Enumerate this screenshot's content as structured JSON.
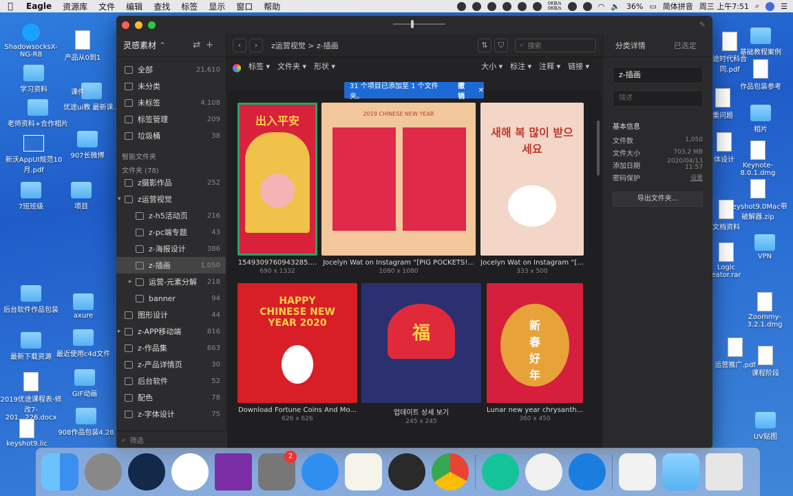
{
  "menubar": {
    "app": "Eagle",
    "items": [
      "资源库",
      "文件",
      "编辑",
      "查找",
      "标签",
      "显示",
      "窗口",
      "帮助"
    ],
    "net_up": "0KB/s",
    "net_down": "0KB/s",
    "battery": "36%",
    "ime": "简体拼音",
    "datetime": "周三 上午7:51"
  },
  "desktop": {
    "left": [
      {
        "label": "ShadowsocksX-NG-R8",
        "kind": "app"
      },
      {
        "label": "产品从0到1",
        "kind": "doc"
      },
      {
        "label": "学习资料",
        "kind": "folder"
      },
      {
        "label": "优途ui教 最新课...",
        "kind": "folder"
      },
      {
        "label": "课件",
        "kind": "folder"
      },
      {
        "label": "老师资料+合作相片",
        "kind": "folder"
      },
      {
        "label": "新沃AppUI规范10月.pdf",
        "kind": "doc"
      },
      {
        "label": "907长微博",
        "kind": "folder"
      },
      {
        "label": "7班班级",
        "kind": "folder"
      },
      {
        "label": "项目",
        "kind": "folder"
      },
      {
        "label": "后台软件作品包装",
        "kind": "folder"
      },
      {
        "label": "axure",
        "kind": "folder"
      },
      {
        "label": "最新下载资源",
        "kind": "folder"
      },
      {
        "label": "最近使用c4d文件",
        "kind": "folder"
      },
      {
        "label": "2019优途课程表-修改7-201...226.docx",
        "kind": "doc"
      },
      {
        "label": "GIF动画",
        "kind": "folder"
      },
      {
        "label": "keyshot9.lic",
        "kind": "doc"
      },
      {
        "label": "908作品包装4.28",
        "kind": "folder"
      }
    ],
    "right": [
      {
        "label": "途时代科合同.pdf",
        "kind": "doc"
      },
      {
        "label": "基础教程案例",
        "kind": "folder"
      },
      {
        "label": "作品包装参考",
        "kind": "doc"
      },
      {
        "label": "重问题",
        "kind": "doc"
      },
      {
        "label": "相片",
        "kind": "folder"
      },
      {
        "label": "体设计",
        "kind": "doc"
      },
      {
        "label": "Keynote-8.0.1.dmg",
        "kind": "doc"
      },
      {
        "label": "keyshot9.0Mac带破解器.zip",
        "kind": "doc"
      },
      {
        "label": "文档资料",
        "kind": "doc"
      },
      {
        "label": "VPN",
        "kind": "folder"
      },
      {
        "label": "Logic eator.rar",
        "kind": "doc"
      },
      {
        "label": "Zoommy-3.2.1.dmg",
        "kind": "doc"
      },
      {
        "label": "运营推广.pdf",
        "kind": "doc"
      },
      {
        "label": "课程阶段",
        "kind": "doc"
      },
      {
        "label": "UV贴图",
        "kind": "folder"
      }
    ]
  },
  "sidebar": {
    "library": "灵感素材",
    "nav": [
      {
        "label": "全部",
        "count": "21,610"
      },
      {
        "label": "未分类",
        "count": ""
      },
      {
        "label": "未标签",
        "count": "4,108"
      },
      {
        "label": "标签管理",
        "count": "209"
      },
      {
        "label": "垃圾桶",
        "count": "38"
      }
    ],
    "smart_label": "智能文件夹",
    "folders_label": "文件夹 (78)",
    "folders": [
      {
        "label": "z摄影作品",
        "count": "252",
        "indent": 0,
        "arrow": ""
      },
      {
        "label": "z运营视觉",
        "count": "",
        "indent": 0,
        "arrow": "▾"
      },
      {
        "label": "z-h5活动页",
        "count": "216",
        "indent": 1,
        "arrow": ""
      },
      {
        "label": "z-pc端专题",
        "count": "43",
        "indent": 1,
        "arrow": ""
      },
      {
        "label": "z-海报设计",
        "count": "386",
        "indent": 1,
        "arrow": ""
      },
      {
        "label": "z-插画",
        "count": "1,050",
        "indent": 1,
        "arrow": "",
        "selected": true
      },
      {
        "label": "运营-元素分解",
        "count": "218",
        "indent": 1,
        "arrow": "▸"
      },
      {
        "label": "banner",
        "count": "94",
        "indent": 1,
        "arrow": ""
      },
      {
        "label": "图形设计",
        "count": "44",
        "indent": 0,
        "arrow": ""
      },
      {
        "label": "z-APP移动端",
        "count": "816",
        "indent": 0,
        "arrow": "▸"
      },
      {
        "label": "z-作品集",
        "count": "663",
        "indent": 0,
        "arrow": ""
      },
      {
        "label": "z-产品详情页",
        "count": "30",
        "indent": 0,
        "arrow": ""
      },
      {
        "label": "后台软件",
        "count": "52",
        "indent": 0,
        "arrow": ""
      },
      {
        "label": "配色",
        "count": "78",
        "indent": 0,
        "arrow": ""
      },
      {
        "label": "z-字体设计",
        "count": "75",
        "indent": 0,
        "arrow": ""
      }
    ],
    "filter_placeholder": "筛选"
  },
  "toolbar": {
    "breadcrumb": "z运营视觉 > z-插画",
    "search_placeholder": "搜索"
  },
  "filters": [
    "标签",
    "文件夹",
    "形状",
    "",
    "",
    "",
    "",
    "大小",
    "标注",
    "注释",
    "链接"
  ],
  "toast": {
    "message": "31 个项目已添加至 1 个文件夹。",
    "undo": "撤销",
    "close": "✕"
  },
  "items": [
    {
      "name": "1549309760943285....",
      "size": "690 x 1332",
      "bg": "#d8213a",
      "caption": "出入平安"
    },
    {
      "name": "Jocelyn Wat on Instagram “[PIG POCKETS!...",
      "size": "1080 x 1080",
      "bg": "#f2c79b",
      "caption": "2019 CHINESE NEW YEAR"
    },
    {
      "name": "Jocelyn Wat on Instagram “[...",
      "size": "333 x 500",
      "bg": "#f4d6c8",
      "caption": "새해 복 많이 받으세요"
    },
    {
      "name": "Download Fortune Coins And Mo...",
      "size": "626 x 626",
      "bg": "#d81e26",
      "caption": "HAPPY CHINESE NEW YEAR 2020"
    },
    {
      "name": "업데이트 상세 보기",
      "size": "245 x 245",
      "bg": "#2b3170",
      "caption": "福"
    },
    {
      "name": "Lunar new year chrysanth...",
      "size": "360 x 450",
      "bg": "#d61f3c",
      "caption": "新春好年"
    }
  ],
  "inspector": {
    "tabs": [
      "分类详情",
      "已选定"
    ],
    "name": "z-插画",
    "desc_placeholder": "描述",
    "section": "基本信息",
    "rows": [
      {
        "k": "文件数",
        "v": "1,050"
      },
      {
        "k": "文件大小",
        "v": "703.2 MB"
      },
      {
        "k": "添加日期",
        "v": "2020/04/13 11:57"
      },
      {
        "k": "密码保护",
        "v": "设置"
      }
    ],
    "export": "导出文件夹..."
  },
  "dock": {
    "badge": "2"
  },
  "colors": {
    "accent": "#1d6ad6",
    "window_bg": "#2a2a2c",
    "selection": "#444444"
  }
}
